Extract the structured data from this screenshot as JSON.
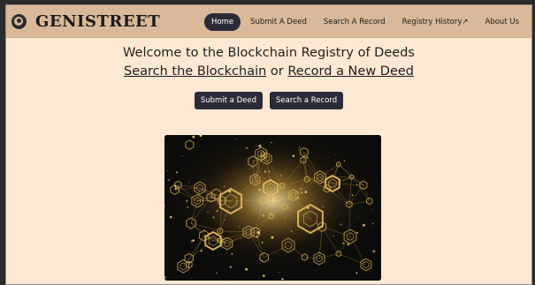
{
  "brand": {
    "name": "GENISTREET",
    "logo_icon": "circle-logo-icon"
  },
  "nav": {
    "items": [
      {
        "label": "Home",
        "active": true
      },
      {
        "label": "Submit A Deed",
        "active": false
      },
      {
        "label": "Search A Record",
        "active": false
      },
      {
        "label": "Registry History↗",
        "active": false
      },
      {
        "label": "About Us",
        "active": false
      }
    ]
  },
  "hero": {
    "title": "Welcome to the Blockchain Registry of Deeds",
    "link_search": "Search the Blockchain",
    "connector": " or ",
    "link_record": "Record a New Deed"
  },
  "actions": {
    "submit_label": "Submit a Deed",
    "search_label": "Search a Record"
  },
  "colors": {
    "page_bg": "#fde8d4",
    "navbar_bg": "#d9b999",
    "button_bg": "#2b2b3a",
    "accent_gold": "#d4a64a"
  }
}
